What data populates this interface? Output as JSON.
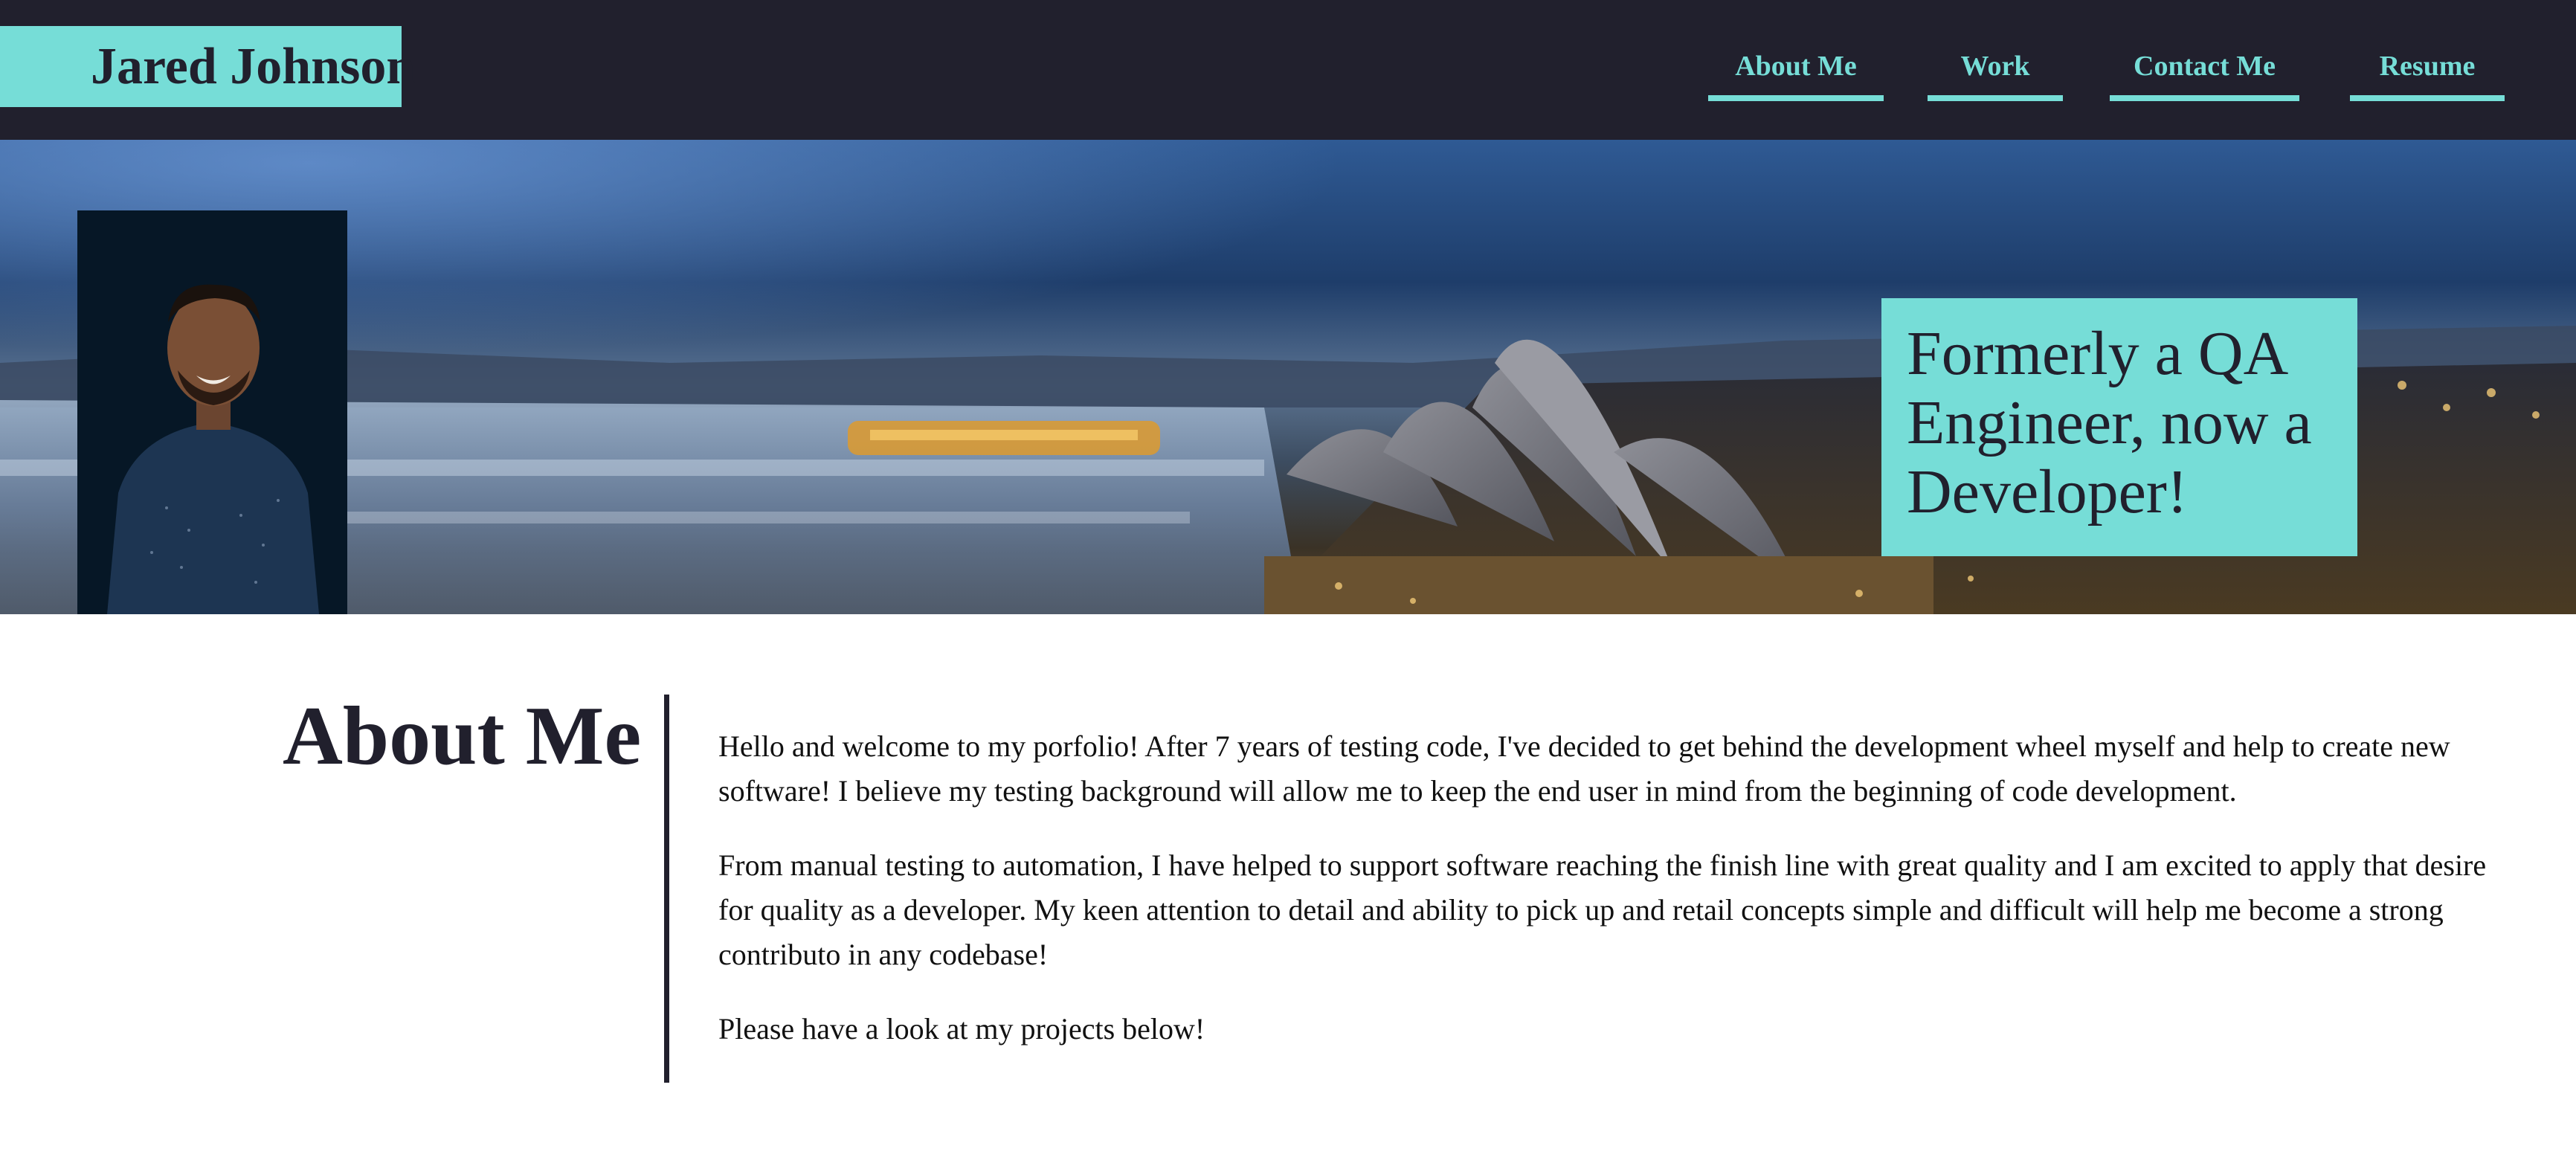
{
  "header": {
    "brand": "Jared Johnson",
    "nav": [
      "About Me",
      "Work",
      "Contact Me",
      "Resume"
    ]
  },
  "hero": {
    "tagline": "Formerly a QA Engineer, now a Developer!"
  },
  "about": {
    "title": "About Me",
    "paragraphs": [
      "Hello and welcome to my porfolio! After 7 years of testing code, I've decided to get behind the development wheel myself and help to create new software! I believe my testing background will allow me to keep the end user in mind from the beginning of code development.",
      "From manual testing to automation, I have helped to support software reaching the finish line with great quality and I am excited to apply that desire for quality as a developer. My keen attention to detail and ability to pick up and retail concepts simple and difficult will help me become a strong contributo in any codebase!",
      "Please have a look at my projects below!"
    ]
  },
  "colors": {
    "accent": "#76ddd7",
    "dark": "#21202d"
  }
}
